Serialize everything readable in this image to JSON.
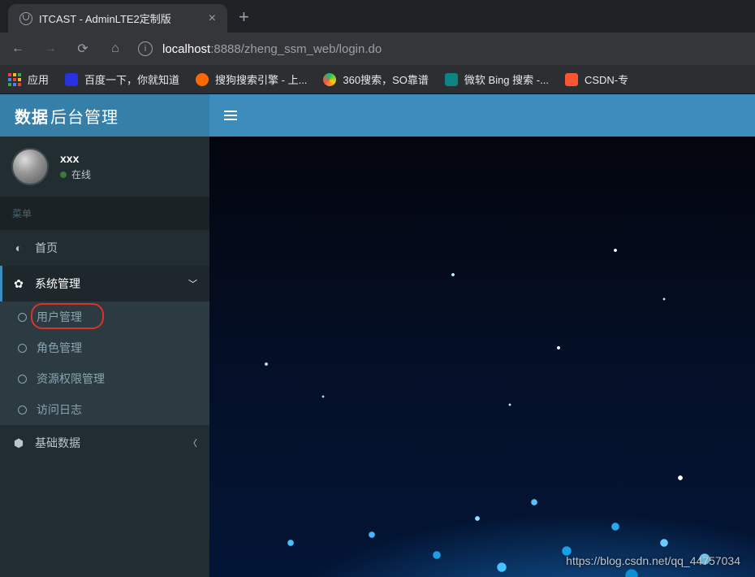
{
  "browser": {
    "tab_title": "ITCAST - AdminLTE2定制版",
    "url_host": "localhost",
    "url_port_path": ":8888/zheng_ssm_web/login.do",
    "bookmarks": {
      "apps": "应用",
      "baidu": "百度一下，你就知道",
      "sogou": "搜狗搜索引擎 - 上...",
      "so360": "360搜索，SO靠谱",
      "bing": "微软 Bing 搜索 -...",
      "csdn": "CSDN-专"
    }
  },
  "app": {
    "logo_bold": "数据",
    "logo_light": "后台管理",
    "user": {
      "name": "xxx",
      "status": "在线"
    },
    "menu_header": "菜单",
    "nav": {
      "home": "首页",
      "system": "系统管理",
      "user_mgmt": "用户管理",
      "role_mgmt": "角色管理",
      "perm_mgmt": "资源权限管理",
      "log": "访问日志",
      "base_data": "基础数据"
    },
    "watermark": "https://blog.csdn.net/qq_44757034"
  }
}
